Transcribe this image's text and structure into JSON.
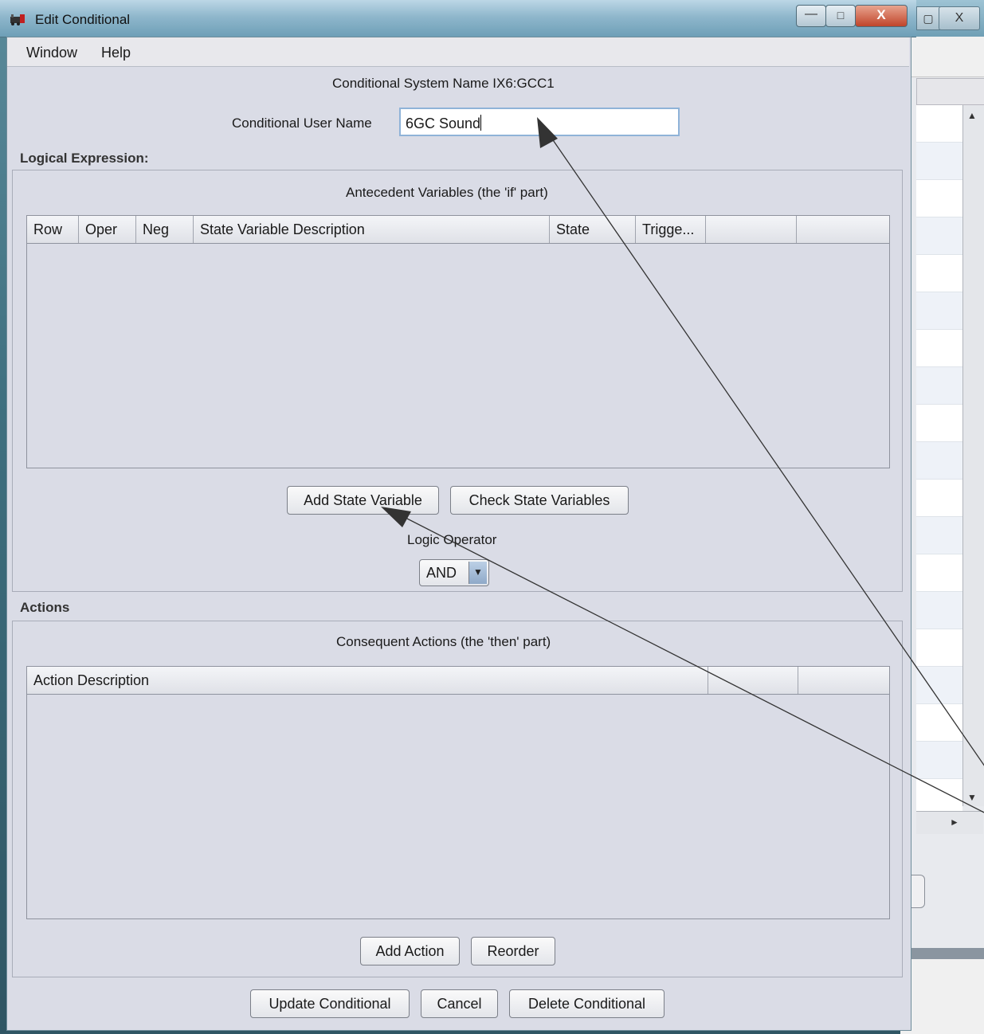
{
  "window": {
    "title": "Edit Conditional",
    "controls": {
      "minimize": "—",
      "maximize": "□",
      "close": "X"
    }
  },
  "background_window": {
    "close": "X"
  },
  "menu": {
    "items": [
      "Window",
      "Help"
    ]
  },
  "system_name": {
    "label": "Conditional System Name",
    "value": "IX6:GCC1"
  },
  "user_name": {
    "label": "Conditional User Name",
    "value": "6GC Sound"
  },
  "logical_expression": {
    "heading": "Logical Expression:",
    "group_title": "Antecedent Variables (the 'if' part)",
    "columns": [
      "Row",
      "Oper",
      "Neg",
      "State Variable Description",
      "State",
      "Trigge...",
      "",
      ""
    ],
    "buttons": {
      "add": "Add State Variable",
      "check": "Check State Variables"
    },
    "logic_operator_label": "Logic Operator",
    "logic_operator_value": "AND"
  },
  "actions": {
    "heading": "Actions",
    "group_title": "Consequent Actions (the 'then' part)",
    "columns": [
      "Action Description",
      "",
      ""
    ],
    "buttons": {
      "add": "Add Action",
      "reorder": "Reorder"
    }
  },
  "footer": {
    "update": "Update Conditional",
    "cancel": "Cancel",
    "delete": "Delete Conditional"
  },
  "icons": [
    "app-icon",
    "dropdown-arrow-icon",
    "scroll-up-icon",
    "scroll-down-icon",
    "scroll-right-icon"
  ]
}
